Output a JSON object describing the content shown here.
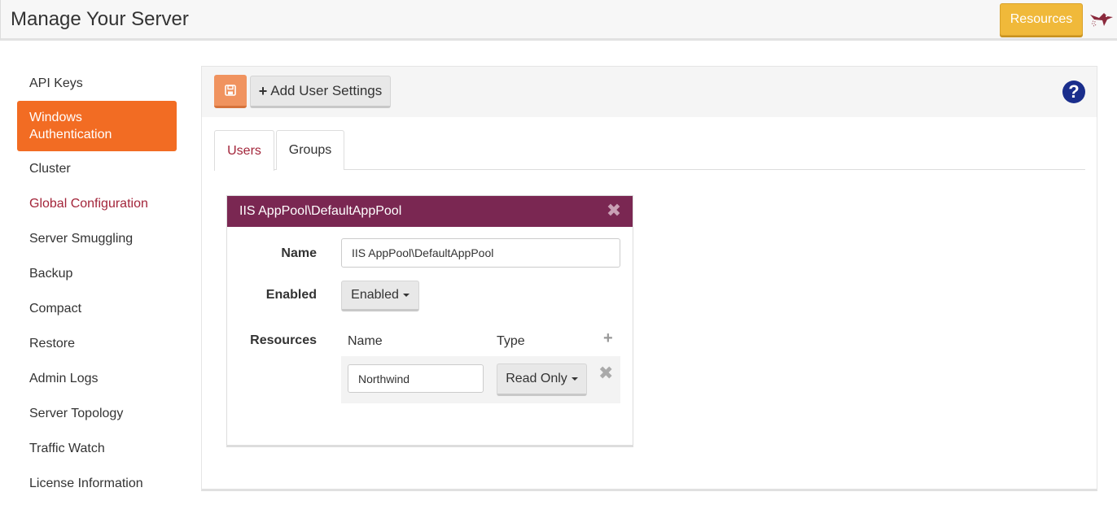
{
  "header": {
    "title": "Manage Your Server",
    "resources_label": "Resources"
  },
  "sidebar": {
    "items": [
      {
        "label": "API Keys"
      },
      {
        "label": "Windows Authentication",
        "line1": "Windows",
        "line2": "Authentication"
      },
      {
        "label": "Cluster"
      },
      {
        "label": "Global Configuration"
      },
      {
        "label": "Server Smuggling"
      },
      {
        "label": "Backup"
      },
      {
        "label": "Compact"
      },
      {
        "label": "Restore"
      },
      {
        "label": "Admin Logs"
      },
      {
        "label": "Server Topology"
      },
      {
        "label": "Traffic Watch"
      },
      {
        "label": "License Information"
      }
    ],
    "active": "Windows Authentication"
  },
  "toolbar": {
    "add_label": "Add User Settings",
    "save_icon": "floppy-disk-icon",
    "help_icon": "question-circle-icon"
  },
  "tabs": [
    {
      "label": "Users",
      "active": true
    },
    {
      "label": "Groups",
      "active": false
    }
  ],
  "card": {
    "title": "IIS AppPool\\DefaultAppPool",
    "name_label": "Name",
    "name_value": "IIS AppPool\\DefaultAppPool",
    "enabled_label": "Enabled",
    "enabled_value": "Enabled",
    "resources_label": "Resources",
    "resources_columns": {
      "name": "Name",
      "type": "Type"
    },
    "resources": [
      {
        "name": "Northwind",
        "type": "Read Only"
      }
    ]
  },
  "colors": {
    "accent_orange": "#f26c23",
    "card_header": "#7a2752",
    "resources_button": "#f0b93a",
    "help_icon": "#1a2e8c"
  }
}
